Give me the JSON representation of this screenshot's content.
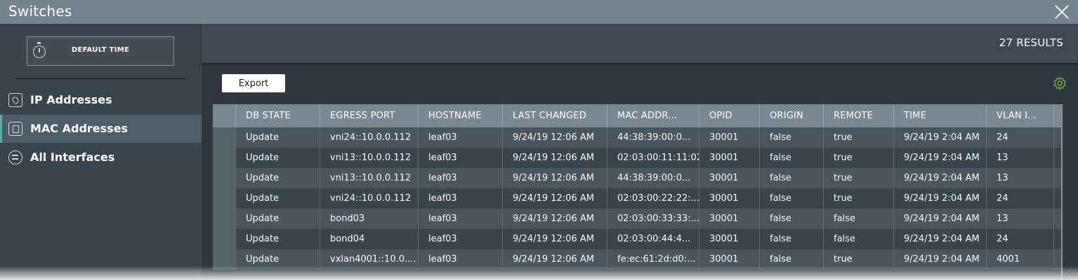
{
  "window": {
    "title": "Switches"
  },
  "sidebar": {
    "time_button": "DEFAULT TIME",
    "items": [
      {
        "label": "IP Addresses",
        "icon": "ip-address-icon",
        "active": false
      },
      {
        "label": "MAC Addresses",
        "icon": "mac-address-icon",
        "active": true
      },
      {
        "label": "All Interfaces",
        "icon": "interfaces-icon",
        "active": false
      }
    ]
  },
  "main": {
    "results": "27 RESULTS",
    "export_label": "Export",
    "table": {
      "columns": [
        "DB STATE",
        "EGRESS PORT",
        "HOSTNAME",
        "LAST CHANGED",
        "MAC ADDR...",
        "OPID",
        "ORIGIN",
        "REMOTE",
        "TIME",
        "VLAN I..."
      ],
      "rows": [
        [
          "Update",
          "vni24::10.0.0.112",
          "leaf03",
          "9/24/19 12:06 AM",
          "44:38:39:00:0...",
          "30001",
          "false",
          "true",
          "9/24/19 2:04 AM",
          "24"
        ],
        [
          "Update",
          "vni13::10.0.0.112",
          "leaf03",
          "9/24/19 12:06 AM",
          "02:03:00:11:11:02",
          "30001",
          "false",
          "true",
          "9/24/19 2:04 AM",
          "13"
        ],
        [
          "Update",
          "vni13::10.0.0.112",
          "leaf03",
          "9/24/19 12:06 AM",
          "44:38:39:00:0...",
          "30001",
          "false",
          "true",
          "9/24/19 2:04 AM",
          "13"
        ],
        [
          "Update",
          "vni24::10.0.0.112",
          "leaf03",
          "9/24/19 12:06 AM",
          "02:03:00:22:22:...",
          "30001",
          "false",
          "true",
          "9/24/19 2:04 AM",
          "24"
        ],
        [
          "Update",
          "bond03",
          "leaf03",
          "9/24/19 12:06 AM",
          "02:03:00:33:33:...",
          "30001",
          "false",
          "false",
          "9/24/19 2:04 AM",
          "13"
        ],
        [
          "Update",
          "bond04",
          "leaf03",
          "9/24/19 12:06 AM",
          "02:03:00:44:4...",
          "30001",
          "false",
          "false",
          "9/24/19 2:04 AM",
          "24"
        ],
        [
          "Update",
          "vxlan4001::10.0....",
          "leaf03",
          "9/24/19 12:06 AM",
          "fe:ec:61:2d:d0:...",
          "30001",
          "false",
          "true",
          "9/24/19 2:04 AM",
          "4001"
        ]
      ]
    }
  },
  "colors": {
    "titlebar": "#77838f",
    "active_accent": "#56b2a8",
    "gear": "#6fb24a"
  }
}
